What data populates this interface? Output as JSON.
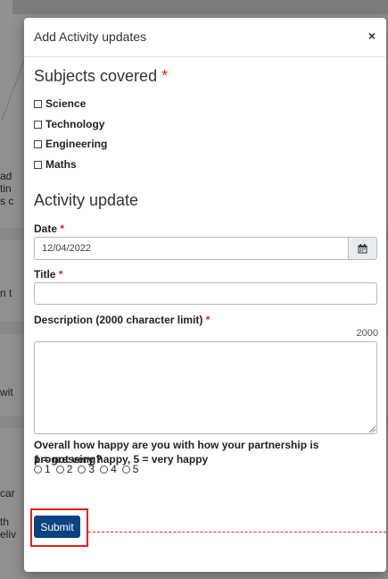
{
  "background": {
    "fragments": [
      "ad",
      "tin",
      "s c",
      "n t",
      "wit",
      "car",
      "th",
      "eliv"
    ]
  },
  "modal": {
    "title": "Add Activity updates",
    "close_glyph": "×"
  },
  "subjects": {
    "heading": "Subjects covered",
    "required_mark": "*",
    "options": [
      "Science",
      "Technology",
      "Engineering",
      "Maths"
    ]
  },
  "activity": {
    "heading": "Activity update",
    "date_label": "Date",
    "date_value": "12/04/2022",
    "title_label": "Title",
    "title_value": "",
    "description_label": "Description (2000 character limit)",
    "description_value": "",
    "char_remaining": "2000",
    "required_mark": "*"
  },
  "happiness": {
    "question": "Overall how happy are you with how your partnership is progressing?",
    "scale": "1 = not very happy, 5 = very happy",
    "options": [
      "1",
      "2",
      "3",
      "4",
      "5"
    ]
  },
  "submit_label": "Submit",
  "colors": {
    "primary": "#0b4381",
    "required": "#e2241b",
    "highlight": "#e2241b"
  },
  "icons": {
    "calendar": "calendar-icon",
    "close": "close-icon"
  }
}
